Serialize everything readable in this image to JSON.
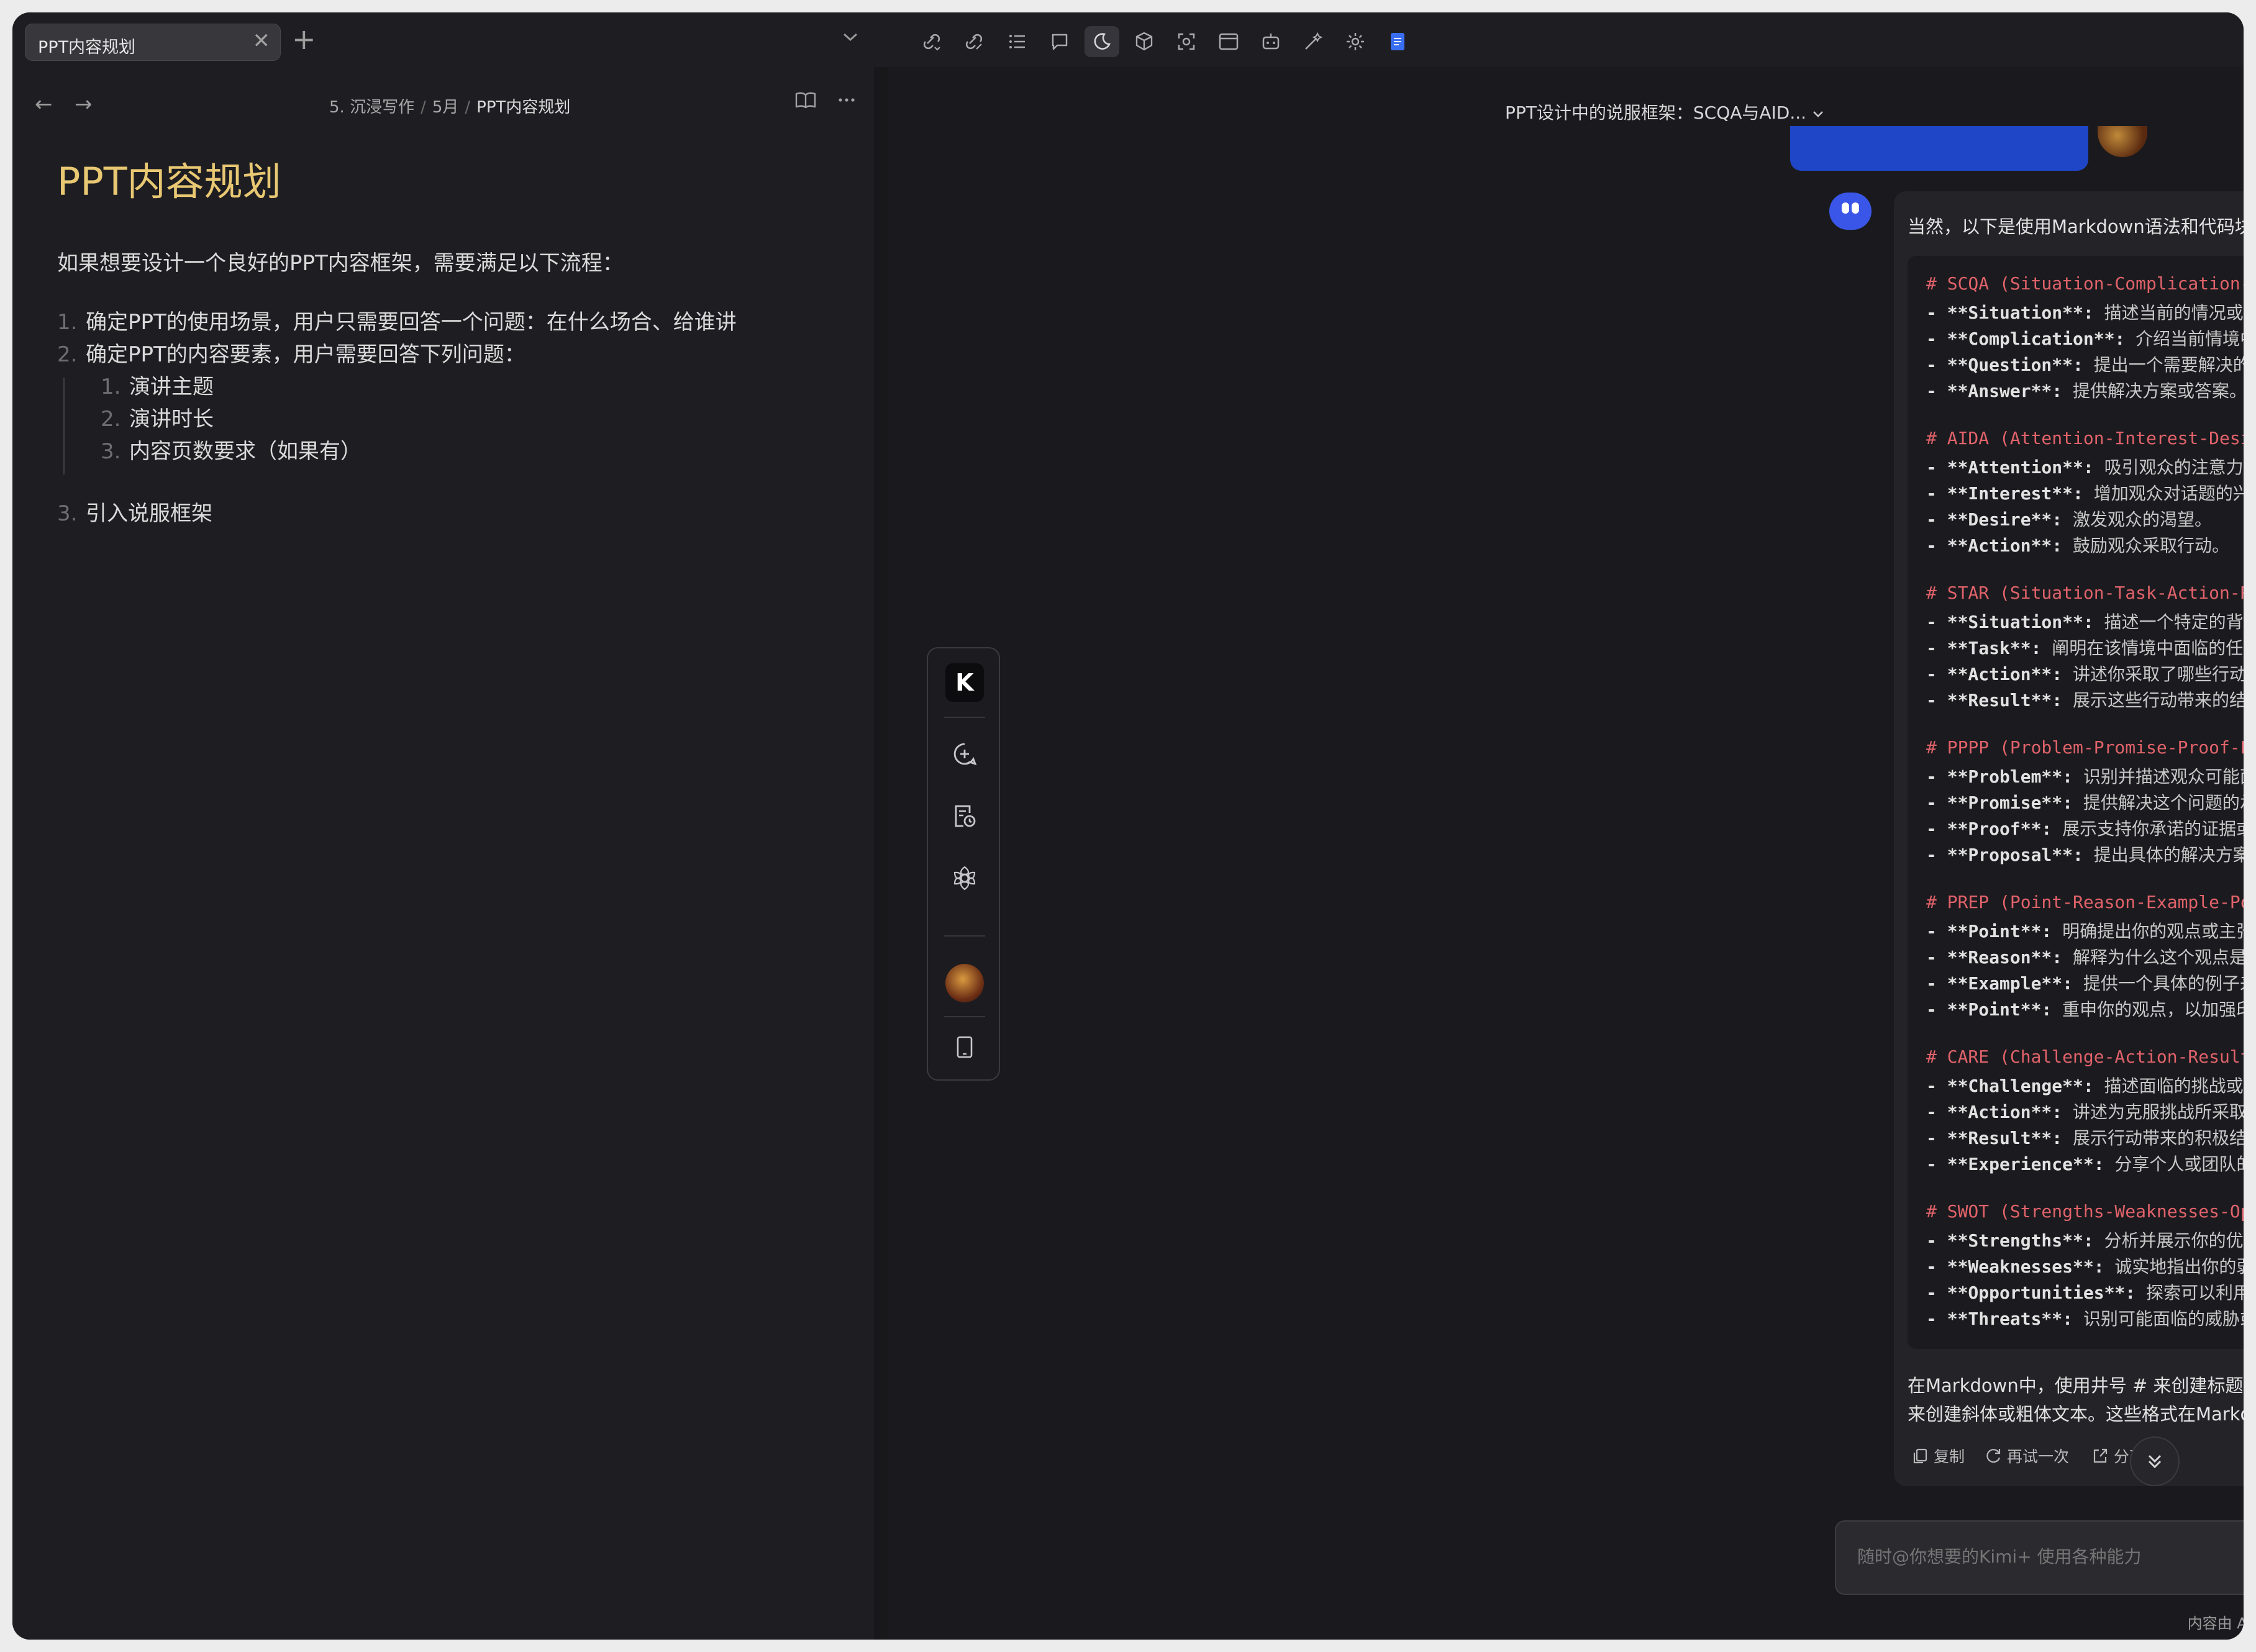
{
  "tab": {
    "title": "PPT内容规划",
    "close": "✕",
    "add": "+"
  },
  "note": {
    "breadcrumb": [
      "5. 沉浸写作",
      "5月",
      "PPT内容规划"
    ],
    "title": "PPT内容规划",
    "intro": "如果想要设计一个良好的PPT内容框架，需要满足以下流程：",
    "items": [
      {
        "num": "1.",
        "text": "确定PPT的使用场景，用户只需要回答一个问题：在什么场合、给谁讲"
      },
      {
        "num": "2.",
        "text": "确定PPT的内容要素，用户需要回答下列问题："
      },
      {
        "num": "3.",
        "text": "引入说服框架"
      }
    ],
    "subitems": [
      {
        "num": "1.",
        "text": "演讲主题"
      },
      {
        "num": "2.",
        "text": "演讲时长"
      },
      {
        "num": "3.",
        "text": "内容页数要求（如果有）"
      }
    ]
  },
  "chat": {
    "title": "PPT设计中的说服框架：SCQA与AID...",
    "intro": "当然，以下是使用Markdown语法和代码块来展示的说服框架的示例：",
    "sections": [
      {
        "header": "# SCQA (Situation-Complication-Question-Answer)",
        "items": [
          {
            "key": "- **Situation**:",
            "desc": " 描述当前的情况或背景。"
          },
          {
            "key": "- **Complication**:",
            "desc": " 介绍当前情境中存在的问题或挑战。"
          },
          {
            "key": "- **Question**:",
            "desc": " 提出一个需要解决的问题或需要回答的疑问。"
          },
          {
            "key": "- **Answer**:",
            "desc": " 提供解决方案或答案。"
          }
        ]
      },
      {
        "header": "# AIDA (Attention-Interest-Desire-Action)",
        "items": [
          {
            "key": "- **Attention**:",
            "desc": " 吸引观众的注意力。"
          },
          {
            "key": "- **Interest**:",
            "desc": " 增加观众对话题的兴趣。"
          },
          {
            "key": "- **Desire**:",
            "desc": " 激发观众的渴望。"
          },
          {
            "key": "- **Action**:",
            "desc": " 鼓励观众采取行动。"
          }
        ]
      },
      {
        "header": "# STAR (Situation-Task-Action-Result)",
        "items": [
          {
            "key": "- **Situation**:",
            "desc": " 描述一个特定的背景或场景。"
          },
          {
            "key": "- **Task**:",
            "desc": " 阐明在该情境中面临的任务或目标。"
          },
          {
            "key": "- **Action**:",
            "desc": " 讲述你采取了哪些行动来完成任务。"
          },
          {
            "key": "- **Result**:",
            "desc": " 展示这些行动带来的结果或成果。"
          }
        ]
      },
      {
        "header": "# PPPP (Problem-Promise-Proof-Proposal)",
        "items": [
          {
            "key": "- **Problem**:",
            "desc": " 识别并描述观众可能面临的问题。"
          },
          {
            "key": "- **Promise**:",
            "desc": " 提供解决这个问题的承诺或保证。"
          },
          {
            "key": "- **Proof**:",
            "desc": " 展示支持你承诺的证据或案例研究。"
          },
          {
            "key": "- **Proposal**:",
            "desc": " 提出具体的解决方案或行动计划。"
          }
        ]
      },
      {
        "header": "# PREP (Point-Reason-Example-Point)",
        "items": [
          {
            "key": "- **Point**:",
            "desc": " 明确提出你的观点或主张。"
          },
          {
            "key": "- **Reason**:",
            "desc": " 解释为什么这个观点是正确的。"
          },
          {
            "key": "- **Example**:",
            "desc": " 提供一个具体的例子来支持你的理由。"
          },
          {
            "key": "- **Point**:",
            "desc": " 重申你的观点，以加强印象。"
          }
        ]
      },
      {
        "header": "# CARE (Challenge-Action-Result-Experience)",
        "items": [
          {
            "key": "- **Challenge**:",
            "desc": " 描述面临的挑战或问题。"
          },
          {
            "key": "- **Action**:",
            "desc": " 讲述为克服挑战所采取的行动。"
          },
          {
            "key": "- **Result**:",
            "desc": " 展示行动带来的积极结果。"
          },
          {
            "key": "- **Experience**:",
            "desc": " 分享个人或团队的体验和学习。"
          }
        ]
      },
      {
        "header": "# SWOT (Strengths-Weaknesses-Opportunities-Threats)",
        "items": [
          {
            "key": "- **Strengths**:",
            "desc": " 分析并展示你的优势或强项。"
          },
          {
            "key": "- **Weaknesses**:",
            "desc": " 诚实地指出你的弱点或不足。"
          },
          {
            "key": "- **Opportunities**:",
            "desc": " 探索可以利用的机会。"
          },
          {
            "key": "- **Threats**:",
            "desc": " 识别可能面临的威胁或风险。"
          }
        ]
      }
    ],
    "outro": "在Markdown中，使用井号 # 来创建标题，使用连字符 - 来创建无序列表，使用星号 * 或下划线 _ 来创建斜体或粗体文本。这些格式在Markdown渲染时会转换成相应的样式。",
    "actions": {
      "copy": "复制",
      "retry": "再试一次",
      "share": "分享"
    },
    "input_placeholder": "随时@你想要的Kimi+ 使用各种能力",
    "disclaimer": "内容由 AI 大模型生成，请仔细甄别"
  },
  "floatbar": {
    "logo": "K"
  },
  "colors": {
    "accent": "#2046c8",
    "title": "#e9c873",
    "code_header": "#e0626a"
  }
}
